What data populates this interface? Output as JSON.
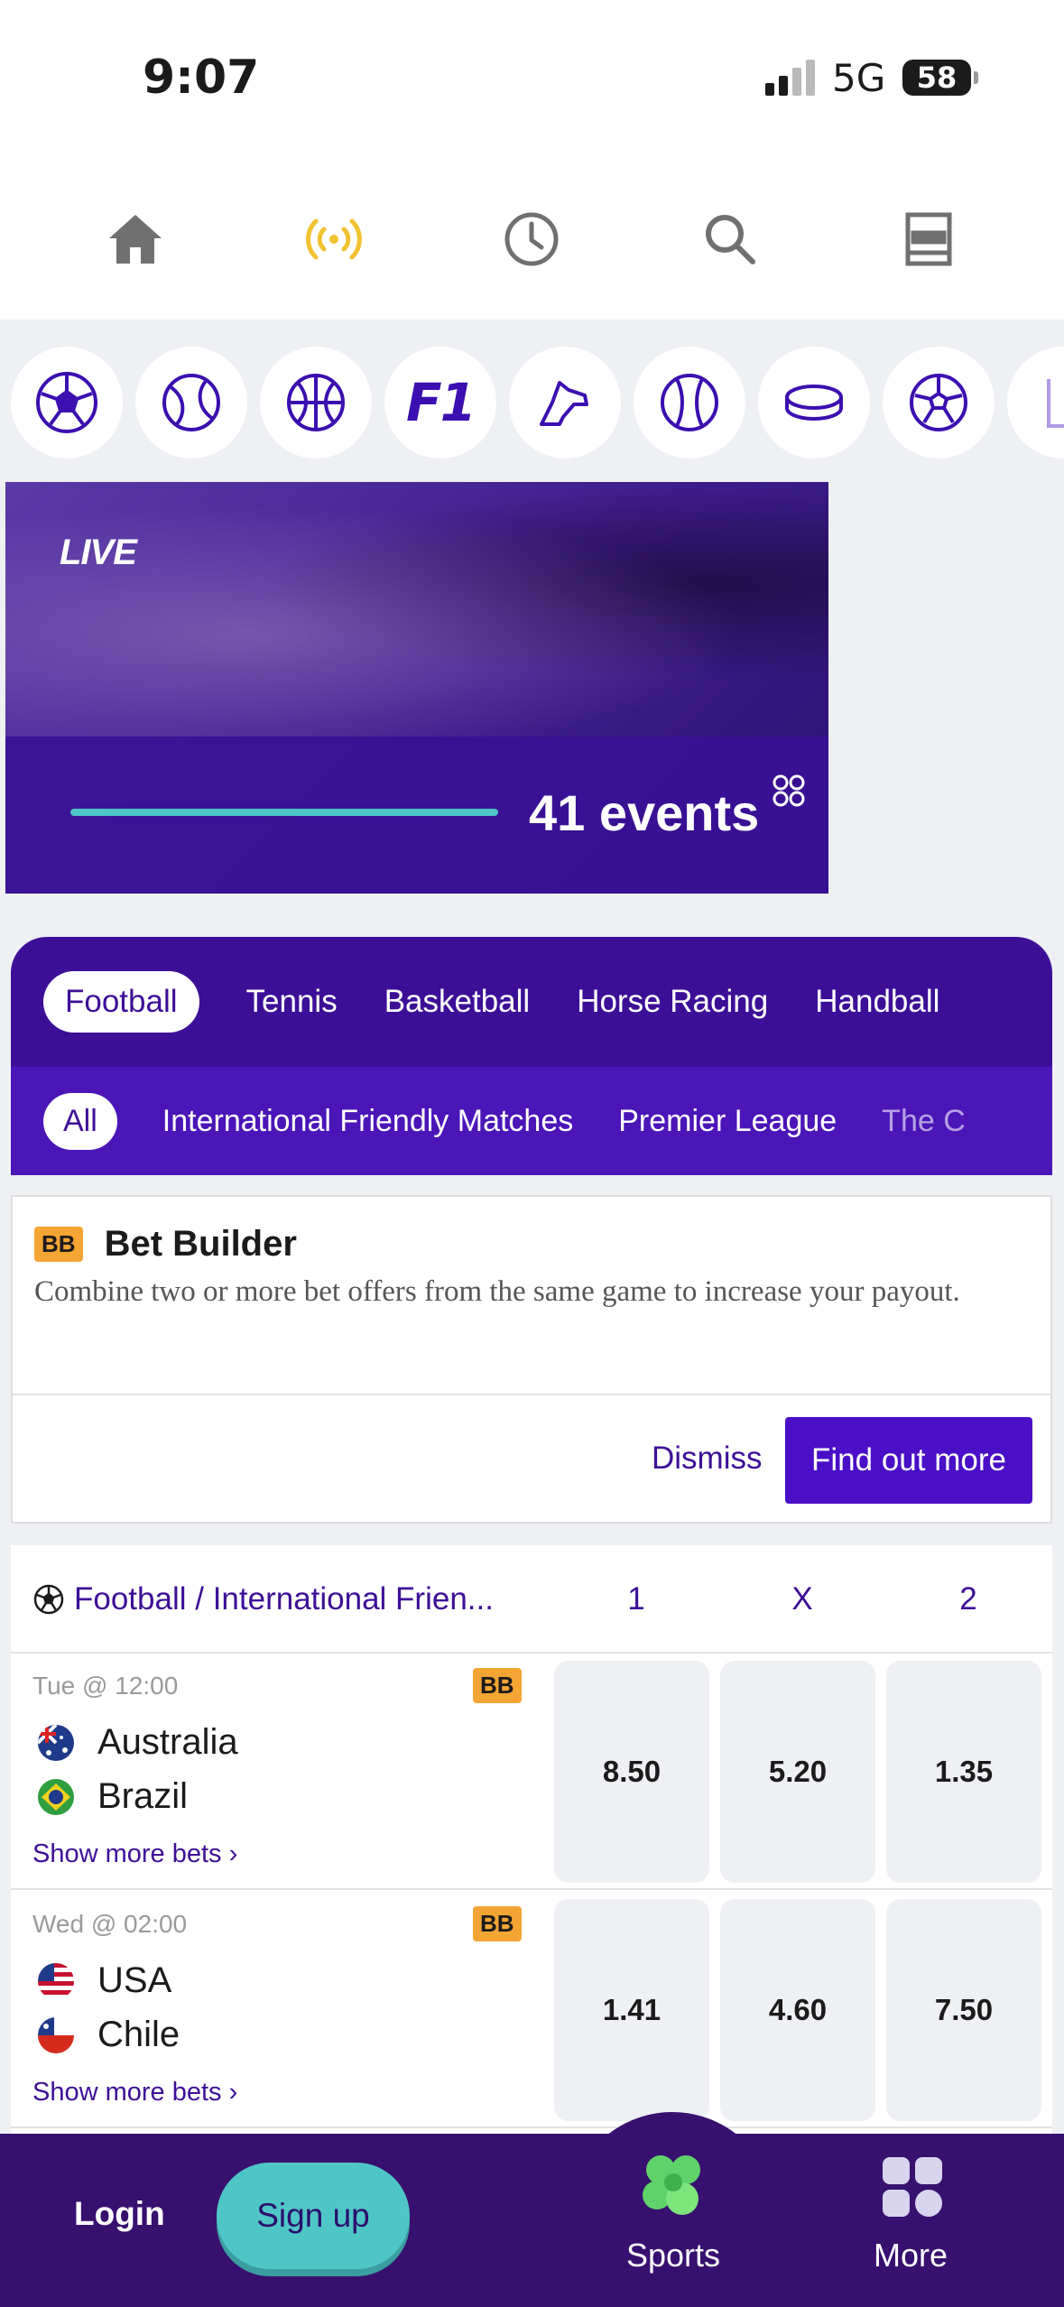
{
  "status_bar": {
    "time": "9:07",
    "network": "5G",
    "battery": "58"
  },
  "top_nav": [
    "home-icon",
    "live-icon",
    "history-icon",
    "search-icon",
    "betslip-icon"
  ],
  "sport_icons": [
    "football-icon",
    "tennis-icon",
    "basketball-icon",
    "f1-icon",
    "horse-racing-icon",
    "baseball-icon",
    "ice-hockey-icon",
    "handball-icon",
    "more-sports-icon"
  ],
  "sport_icon_f1_text": "F1",
  "live_banner": {
    "label": "LIVE",
    "events": "41 events"
  },
  "sport_tabs": [
    "Football",
    "Tennis",
    "Basketball",
    "Horse Racing",
    "Handball"
  ],
  "league_tabs": [
    "All",
    "International Friendly Matches",
    "Premier League",
    "The C"
  ],
  "bet_builder": {
    "badge": "BB",
    "title": "Bet Builder",
    "description": "Combine two or more bet offers from the same game to increase your payout.",
    "dismiss": "Dismiss",
    "find_out_more": "Find out more"
  },
  "event_list": {
    "league": "Football / International Frien...",
    "columns": [
      "1",
      "X",
      "2"
    ],
    "show_more": "Show more bets ›",
    "events": [
      {
        "time": "Tue @ 12:00",
        "badge": "BB",
        "home": "Australia",
        "away": "Brazil",
        "odds": [
          "8.50",
          "5.20",
          "1.35"
        ]
      },
      {
        "time": "Wed @ 02:00",
        "badge": "BB",
        "home": "USA",
        "away": "Chile",
        "odds": [
          "1.41",
          "4.60",
          "7.50"
        ]
      }
    ]
  },
  "bottom_bar": {
    "login": "Login",
    "signup": "Sign up",
    "sports": "Sports",
    "more": "More"
  },
  "colors": {
    "primary": "#3d0f97",
    "accent": "#4fc6c6",
    "badge": "#f4a534",
    "live_icon": "#f2c230"
  }
}
